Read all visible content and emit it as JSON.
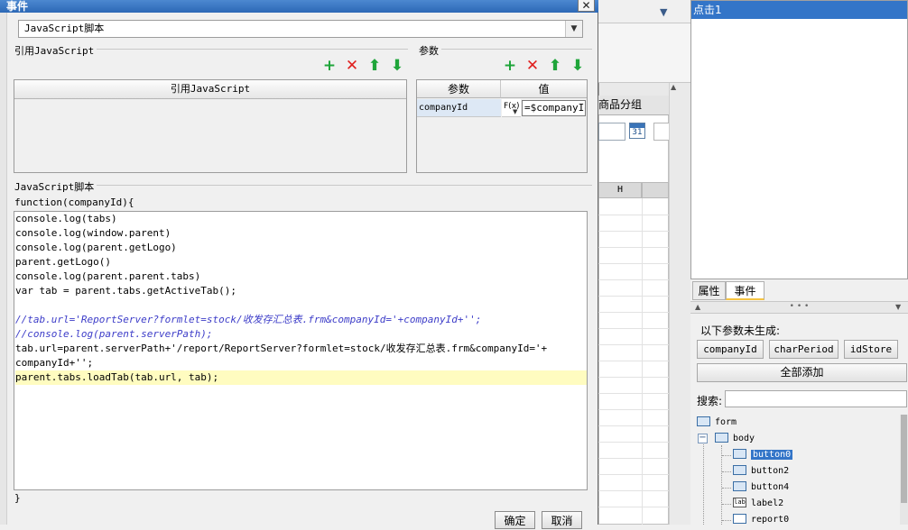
{
  "dialog": {
    "title": "事件",
    "close_glyph": "✕",
    "type_select_value": "JavaScript脚本",
    "referenced_js": {
      "section_title": "引用JavaScript",
      "column_header": "引用JavaScript"
    },
    "params": {
      "section_title": "参数",
      "header_name": "参数",
      "header_value": "值",
      "rows": [
        {
          "name": "companyId",
          "fx": "F(x)",
          "value": "=$companyId"
        }
      ]
    },
    "script": {
      "section_title": "JavaScript脚本",
      "header": "function(companyId){",
      "footer": "}",
      "lines": [
        "console.log(tabs)",
        "console.log(window.parent)",
        "console.log(parent.getLogo)",
        "parent.getLogo()",
        "console.log(parent.parent.tabs)",
        "var tab = parent.tabs.getActiveTab();",
        "",
        "//tab.url='ReportServer?formlet=stock/收发存汇总表.frm&companyId='+companyId+'';",
        "//console.log(parent.serverPath);",
        "tab.url=parent.serverPath+'/report/ReportServer?formlet=stock/收发存汇总表.frm&companyId='+",
        "companyId+'';",
        "parent.tabs.loadTab(tab.url, tab);"
      ]
    },
    "ok_label": "确定",
    "cancel_label": "取消"
  },
  "toolbar_icons": [
    "add-icon",
    "delete-icon",
    "move-up-icon",
    "move-down-icon"
  ],
  "colors": {
    "add": "#1ea53a",
    "delete": "#e0201e",
    "selection": "#3375c8",
    "code_highlight": "#fffcc0",
    "string": "#a0228a",
    "comment": "#3c3cc8"
  },
  "background_app": {
    "tab_label": "商品分组",
    "calendar_day": "31",
    "column_header": "H"
  },
  "event_panel": {
    "selected_event": "点击1",
    "tab_properties": "属性",
    "tab_events": "事件",
    "missing_params_title": "以下参数未生成:",
    "missing_params": [
      "companyId",
      "charPeriod",
      "idStore"
    ],
    "add_all_label": "全部添加",
    "search_label": "搜索:",
    "search_value": "",
    "tree": {
      "root": "form",
      "body": "body",
      "children": [
        "button0",
        "button2",
        "button4",
        "label2",
        "report0"
      ],
      "selected": "button0"
    }
  }
}
